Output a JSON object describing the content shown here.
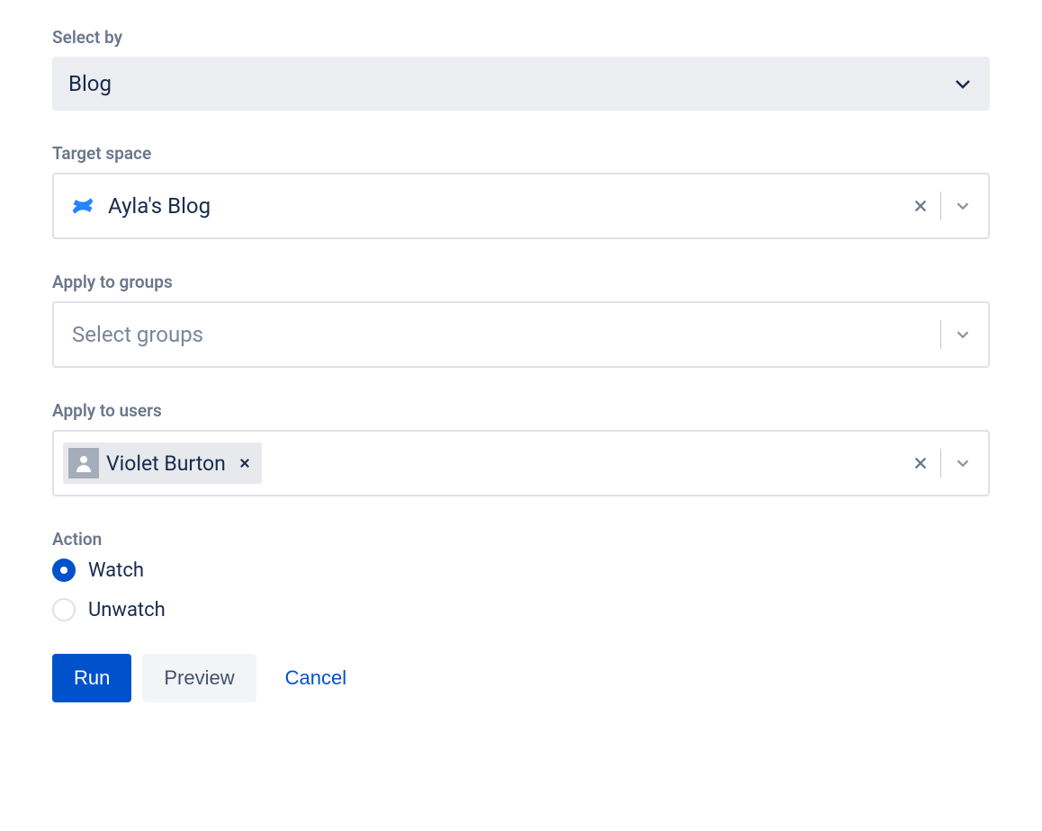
{
  "select_by": {
    "label": "Select by",
    "value": "Blog"
  },
  "target_space": {
    "label": "Target space",
    "value": "Ayla's Blog"
  },
  "apply_groups": {
    "label": "Apply to groups",
    "placeholder": "Select groups"
  },
  "apply_users": {
    "label": "Apply to users",
    "chips": [
      {
        "name": "Violet Burton"
      }
    ]
  },
  "action": {
    "label": "Action",
    "options": [
      {
        "label": "Watch",
        "selected": true
      },
      {
        "label": "Unwatch",
        "selected": false
      }
    ]
  },
  "buttons": {
    "run": "Run",
    "preview": "Preview",
    "cancel": "Cancel"
  }
}
